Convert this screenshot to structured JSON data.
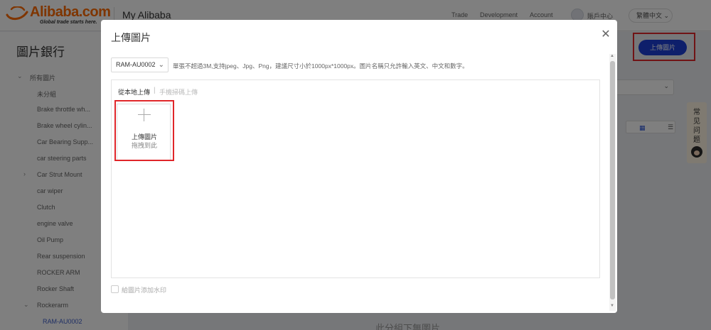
{
  "header": {
    "brand": "Alibaba.com",
    "tagline": "Global trade starts here.",
    "app_title": "My Alibaba",
    "nav": [
      "Trade",
      "Development",
      "Account"
    ],
    "user_label": "賬戶中心",
    "language": "繁體中文"
  },
  "sidebar": {
    "title": "圖片銀行",
    "root": "所有圖片",
    "items": [
      "未分組",
      "Brake throttle wh...",
      "Brake wheel cylin...",
      "Car Bearing Supp...",
      "car steering parts",
      "Car Strut Mount",
      "car wiper",
      "Clutch",
      "engine valve",
      "Oil Pump",
      "Rear suspension",
      "ROCKER ARM",
      "Rocker Shaft",
      "Rockerarm",
      "RAM-AU0002"
    ]
  },
  "background": {
    "upload_button": "上傳圖片",
    "help_chars": [
      "常",
      "见",
      "问",
      "题"
    ],
    "empty_message": "此分組下無圖片"
  },
  "modal": {
    "title": "上傳圖片",
    "close_icon": "close-icon",
    "folder_value": "RAM-AU0002",
    "hint": "單張不超過3M,支持jpeg、Jpg、Png，建議尺寸小於1000px*1000px。圖片名稱只允許輸入英文、中文和數字。",
    "tabs": {
      "local": "從本地上傳",
      "divider": "|",
      "mobile": "手機掃碼上傳"
    },
    "dropzone": {
      "label": "上傳圖片",
      "sublabel": "拖拽到此"
    },
    "watermark_label": "給圖片添加水印"
  },
  "colors": {
    "primary_blue": "#1d3fd6",
    "highlight_red": "#e0262a",
    "brand_orange": "#ff6a00"
  }
}
